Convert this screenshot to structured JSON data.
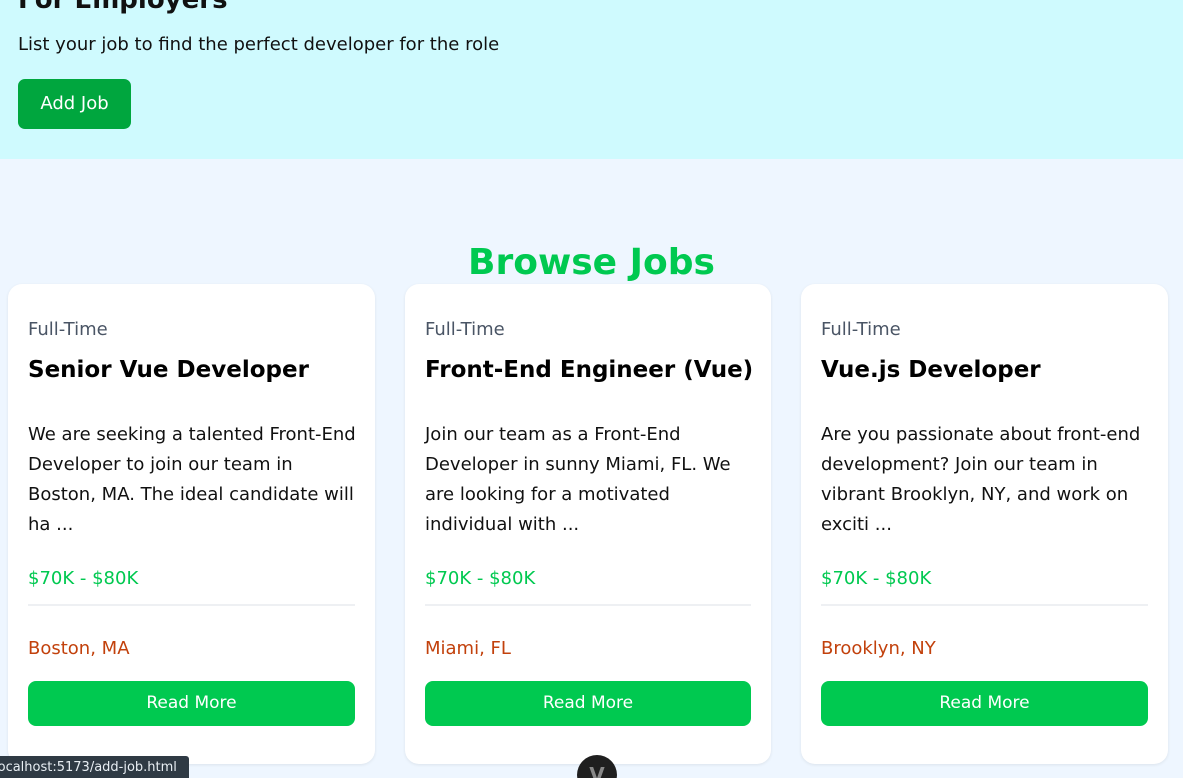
{
  "employers": {
    "title": "For Employers",
    "subtitle": "List your job to find the perfect developer for the role",
    "button_label": "Add Job"
  },
  "browse": {
    "title": "Browse Jobs"
  },
  "jobs": [
    {
      "type": "Full-Time",
      "title": "Senior Vue Developer",
      "description": "We are seeking a talented Front-End Developer to join our team in Boston, MA. The ideal candidate will ha ...",
      "salary": "$70K - $80K",
      "location": "Boston, MA",
      "button_label": "Read More"
    },
    {
      "type": "Full-Time",
      "title": "Front-End Engineer (Vue)",
      "description": "Join our team as a Front-End Developer in sunny Miami, FL. We are looking for a motivated individual with ...",
      "salary": "$70K - $80K",
      "location": "Miami, FL",
      "button_label": "Read More"
    },
    {
      "type": "Full-Time",
      "title": "Vue.js Developer",
      "description": "Are you passionate about front-end development? Join our team in vibrant Brooklyn, NY, and work on exciti ...",
      "salary": "$70K - $80K",
      "location": "Brooklyn, NY",
      "button_label": "Read More"
    }
  ],
  "status_bar": {
    "url": "localhost:5173/add-job.html"
  },
  "devtools": {
    "icon": "vue-devtools-icon",
    "glyph": "V"
  },
  "colors": {
    "hero_bg": "#cffafe",
    "page_bg": "#eef6ff",
    "accent_green": "#00c950",
    "add_job_green": "#00a63e",
    "location_orange": "#c2410c"
  }
}
